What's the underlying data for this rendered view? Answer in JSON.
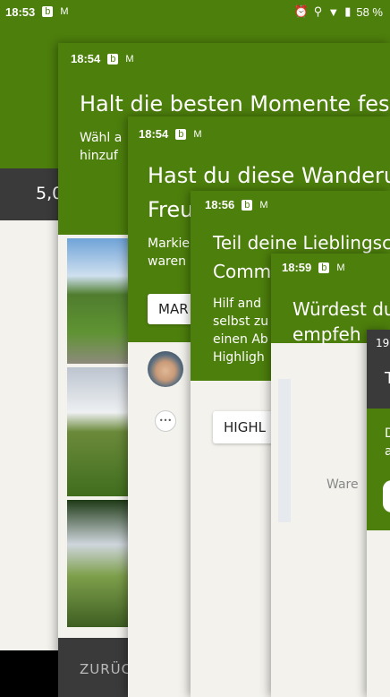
{
  "base": {
    "time": "18:53",
    "battery": "58 %",
    "stat_value": "5,0"
  },
  "card1": {
    "time": "18:54",
    "title": "Halt die besten Momente fes",
    "sub_line1": "Wähl a",
    "sub_line2": "hinzuf",
    "back_label": "ZURÜC"
  },
  "card2": {
    "time": "18:54",
    "title_line1": "Hast du diese Wanderu",
    "title_line2": "Freu",
    "sub_line1": "Markie",
    "sub_line2": "waren",
    "button_label": "MAR",
    "more": "•••"
  },
  "card3": {
    "time": "18:56",
    "title_line1": "Teil deine Lieblingsc",
    "title_line2": "Comm",
    "sub_lines": [
      "Hilf and",
      "selbst zu",
      "einen Ab",
      "Highligh"
    ],
    "button_label": "HIGHL"
  },
  "card4": {
    "time": "18:59",
    "title_line1": "Würdest du",
    "title_line2": "empfeh",
    "sub": "Ware"
  },
  "card5": {
    "time": "19",
    "title": "T",
    "sub_line1": "D",
    "sub_line2": "a"
  },
  "status_icons": {
    "b": "b",
    "mail": "M",
    "alarm": "⏰",
    "location": "⚲",
    "wifi": "▼",
    "signal": "◢",
    "battery": "▮"
  },
  "colors": {
    "header_green": "#4d7f0c",
    "dark": "#3a3a3a",
    "page_bg": "#f3f2ec"
  }
}
